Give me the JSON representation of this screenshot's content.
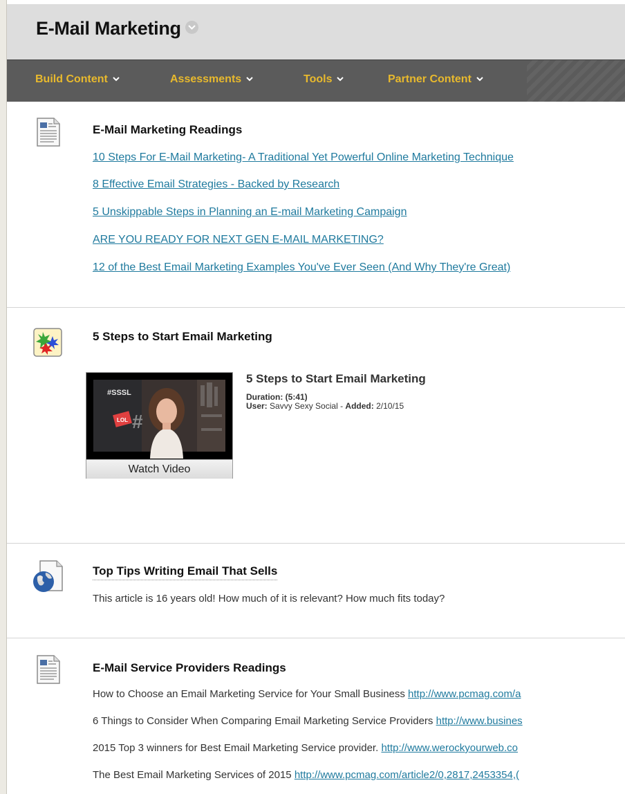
{
  "header": {
    "title": "E-Mail Marketing"
  },
  "toolbar": {
    "items": [
      {
        "label": "Build Content"
      },
      {
        "label": "Assessments"
      },
      {
        "label": "Tools"
      },
      {
        "label": "Partner Content"
      }
    ]
  },
  "colors": {
    "toolbar_bg": "#5b5b5b",
    "toolbar_text": "#e8b92d",
    "link": "#1f7a9e",
    "header_bg": "#dddddd"
  },
  "content_items": [
    {
      "icon": "document-icon",
      "title": "E-Mail Marketing Readings",
      "links": [
        "10 Steps For E-Mail Marketing- A Traditional Yet Powerful Online Marketing Technique",
        "8 Effective Email Strategies - Backed by Research",
        "5 Unskippable Steps in Planning an E-mail Marketing Campaign",
        "ARE YOU READY FOR NEXT GEN E-MAIL MARKETING?",
        "12 of the Best Email Marketing Examples You've Ever Seen (And Why They're Great)"
      ]
    },
    {
      "icon": "mashup-icon",
      "title": "5 Steps to Start Email Marketing",
      "video": {
        "title": "5 Steps to Start Email Marketing",
        "duration_label": "Duration:",
        "duration": "(5:41)",
        "user_label": "User:",
        "user": "Savvy Sexy Social",
        "added_label": "Added:",
        "added": "2/10/15",
        "watch_label": "Watch Video",
        "thumb_text_1": "#SSSL",
        "thumb_text_2": "LOL"
      }
    },
    {
      "icon": "web-link-icon",
      "title": "Top Tips Writing Email That Sells",
      "description": "This article is 16 years old!  How much of it is relevant? How much fits today?"
    },
    {
      "icon": "document-icon",
      "title": "E-Mail Service Providers Readings",
      "rows": [
        {
          "text": "How to Choose an Email Marketing Service for Your Small Business",
          "url": "http://www.pcmag.com/a"
        },
        {
          "text": "6 Things to Consider When Comparing Email Marketing Service Providers",
          "url": "http://www.busines"
        },
        {
          "text": "2015 Top 3 winners for Best Email Marketing Service provider.",
          "url": "http://www.werockyourweb.co"
        },
        {
          "text": "The Best Email Marketing Services of 2015",
          "url": "http://www.pcmag.com/article2/0,2817,2453354,("
        }
      ]
    }
  ]
}
